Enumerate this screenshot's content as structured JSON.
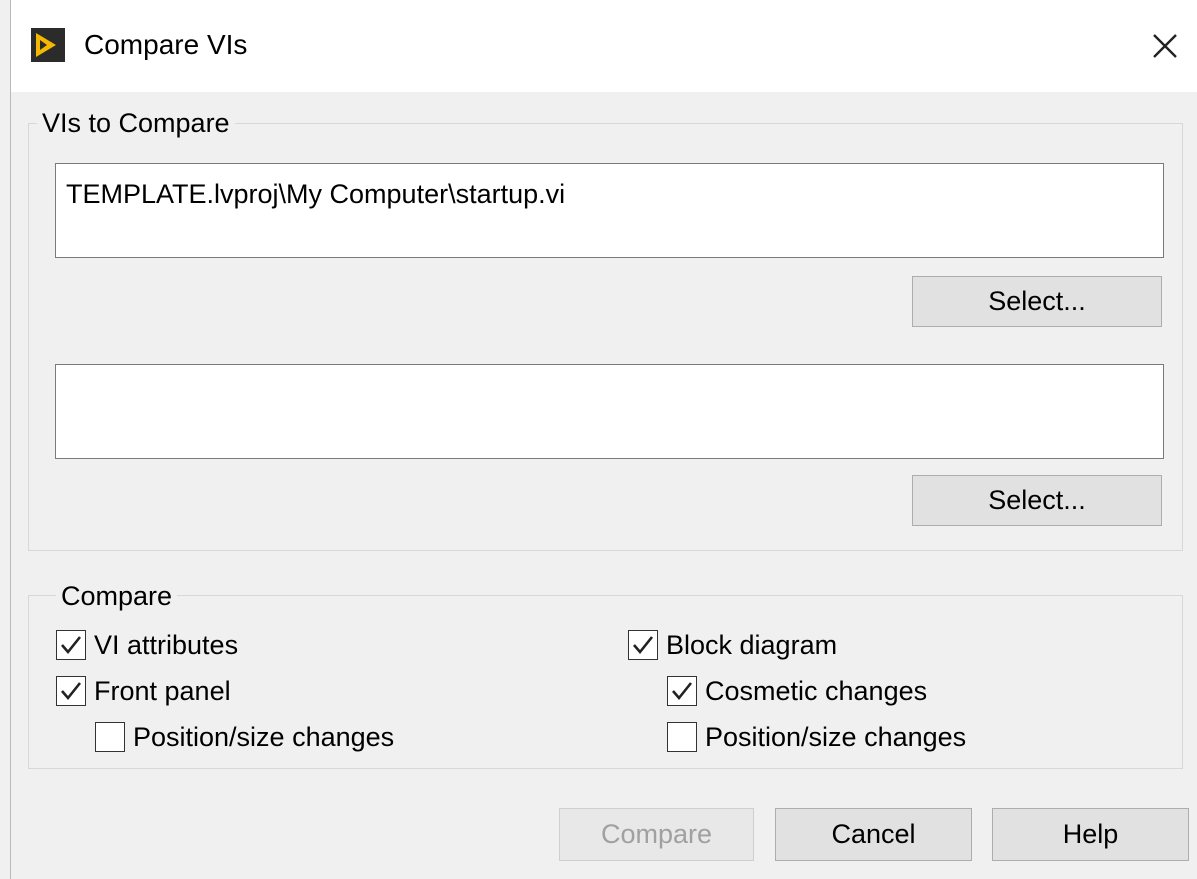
{
  "window": {
    "title": "Compare VIs",
    "app_icon": "labview-icon",
    "close_icon": "close-icon"
  },
  "vis_group": {
    "title": "VIs to Compare",
    "vi1": {
      "value": "TEMPLATE.lvproj\\My Computer\\startup.vi",
      "select_label": "Select..."
    },
    "vi2": {
      "value": "",
      "select_label": "Select..."
    }
  },
  "compare_group": {
    "title": "Compare",
    "options": {
      "vi_attributes": {
        "label": "VI attributes",
        "checked": true
      },
      "front_panel": {
        "label": "Front panel",
        "checked": true
      },
      "fp_position_size": {
        "label": "Position/size changes",
        "checked": false
      },
      "block_diagram": {
        "label": "Block diagram",
        "checked": true
      },
      "bd_cosmetic": {
        "label": "Cosmetic changes",
        "checked": true
      },
      "bd_position_size": {
        "label": "Position/size changes",
        "checked": false
      }
    }
  },
  "buttons": {
    "compare": "Compare",
    "cancel": "Cancel",
    "help": "Help"
  },
  "colors": {
    "icon_bg": "#2b2b2b",
    "icon_accent": "#f5b800"
  }
}
